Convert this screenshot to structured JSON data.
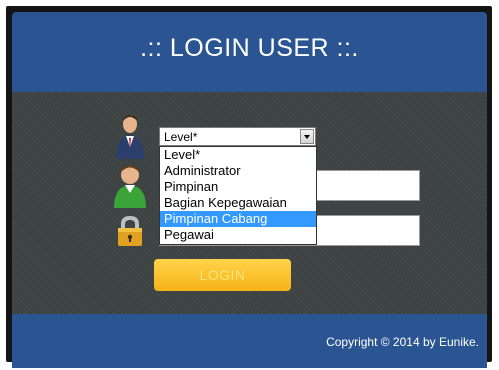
{
  "header": {
    "title": ".:: LOGIN USER ::."
  },
  "form": {
    "level_select": {
      "selected": "Level*",
      "options": [
        {
          "label": "Level*",
          "highlighted": false
        },
        {
          "label": "Administrator",
          "highlighted": false
        },
        {
          "label": "Pimpinan",
          "highlighted": false
        },
        {
          "label": "Bagian Kepegawaian",
          "highlighted": false
        },
        {
          "label": "Pimpinan Cabang",
          "highlighted": true
        },
        {
          "label": "Pegawai",
          "highlighted": false
        }
      ]
    },
    "username": {
      "value": ""
    },
    "password": {
      "value": ""
    },
    "login_label": "LOGIN"
  },
  "icons": {
    "level": "businessman-icon",
    "username": "user-icon",
    "password": "padlock-icon"
  },
  "footer": {
    "copyright": "Copyright © 2014 by Eunike."
  },
  "colors": {
    "header_bg": "#2b5592",
    "body_bg": "#3a4140",
    "button": "#f6b417",
    "highlight": "#3399ff"
  }
}
